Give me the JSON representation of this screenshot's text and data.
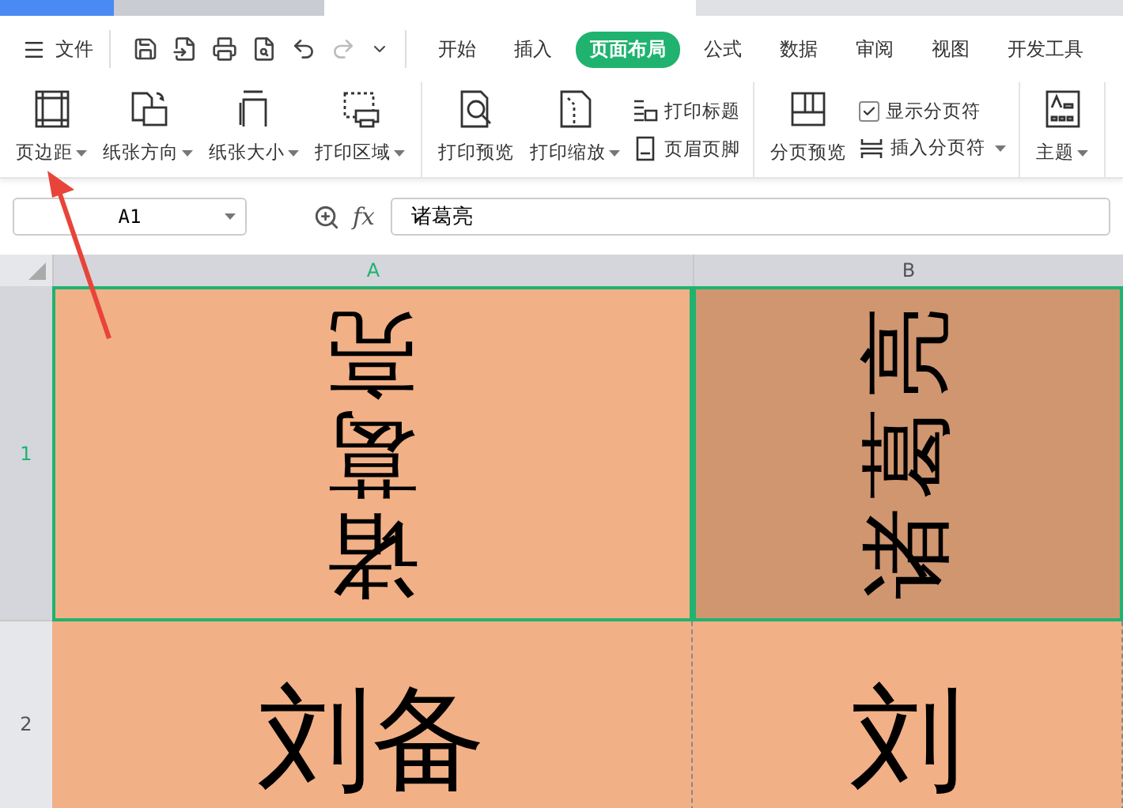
{
  "menu": {
    "label": "文件"
  },
  "tabs": [
    {
      "label": "开始",
      "selected": false
    },
    {
      "label": "插入",
      "selected": false
    },
    {
      "label": "页面布局",
      "selected": true
    },
    {
      "label": "公式",
      "selected": false
    },
    {
      "label": "数据",
      "selected": false
    },
    {
      "label": "审阅",
      "selected": false
    },
    {
      "label": "视图",
      "selected": false
    },
    {
      "label": "开发工具",
      "selected": false
    }
  ],
  "ribbon": [
    {
      "items": [
        {
          "kind": "large",
          "label": "页边距",
          "dropdown": true
        },
        {
          "kind": "large",
          "label": "纸张方向",
          "dropdown": true
        },
        {
          "kind": "large",
          "label": "纸张大小",
          "dropdown": true
        },
        {
          "kind": "large",
          "label": "打印区域",
          "dropdown": true
        }
      ]
    },
    {
      "items": [
        {
          "kind": "large",
          "label": "打印预览",
          "dropdown": false
        },
        {
          "kind": "large",
          "label": "打印缩放",
          "dropdown": true
        },
        {
          "kind": "small",
          "label": "打印标题",
          "dropdown": false
        },
        {
          "kind": "small",
          "label": "页眉页脚",
          "dropdown": false
        }
      ]
    },
    {
      "items": [
        {
          "kind": "large",
          "label": "分页预览",
          "dropdown": false
        },
        {
          "kind": "check",
          "label": "显示分页符",
          "checked": true
        },
        {
          "kind": "small",
          "label": "插入分页符",
          "dropdown": true
        }
      ]
    },
    {
      "items": [
        {
          "kind": "large",
          "label": "主题",
          "dropdown": true
        }
      ]
    }
  ],
  "name_box": {
    "value": "A1"
  },
  "formula_bar": {
    "function_label": "fx",
    "value": "诸葛亮"
  },
  "columns": [
    {
      "label": "A",
      "selected": true
    },
    {
      "label": "B",
      "selected": false
    }
  ],
  "rows": [
    {
      "label": "1",
      "selected": true,
      "cells": [
        {
          "text": "诸葛亮",
          "kind": "flipped",
          "color": "#f2b086"
        },
        {
          "text": "诸葛亮",
          "kind": "sideways",
          "color": "#d09670"
        }
      ]
    },
    {
      "label": "2",
      "selected": false,
      "cells": [
        {
          "text": "刘备",
          "kind": "horizontal",
          "color": "#f2b086"
        },
        {
          "text": "刘",
          "kind": "horizontal",
          "color": "#f2b086"
        }
      ]
    }
  ]
}
